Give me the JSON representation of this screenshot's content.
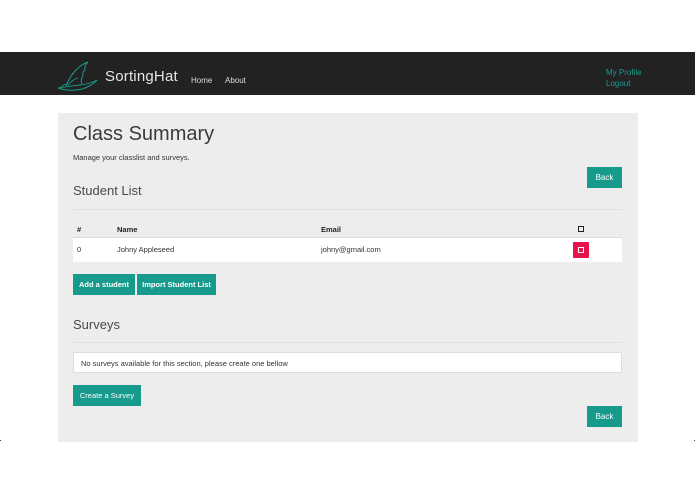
{
  "navbar": {
    "brand": "SortingHat",
    "links": [
      {
        "label": "Home"
      },
      {
        "label": "About"
      }
    ],
    "right_links": [
      {
        "label": "My Profile"
      },
      {
        "label": "Logout"
      }
    ]
  },
  "main": {
    "title": "Class Summary",
    "subtitle": "Manage your classlist and surveys.",
    "back_label": "Back",
    "student_list": {
      "title": "Student List",
      "columns": [
        "#",
        "Name",
        "Email"
      ],
      "rows": [
        {
          "num": "0",
          "name": "Johny Appleseed",
          "email": "johny@gmail.com"
        }
      ],
      "add_label": "Add a student",
      "import_label": "Import Student List"
    },
    "surveys": {
      "title": "Surveys",
      "empty_message": "No surveys available for this section, please create one bellow",
      "create_label": "Create a Survey"
    }
  },
  "colors": {
    "navbar_bg": "#222222",
    "accent": "#159a8b",
    "danger": "#e8134a",
    "panel_bg": "#ededed"
  },
  "icons": [
    "hat-logo-icon",
    "checkbox-icon",
    "delete-icon"
  ]
}
